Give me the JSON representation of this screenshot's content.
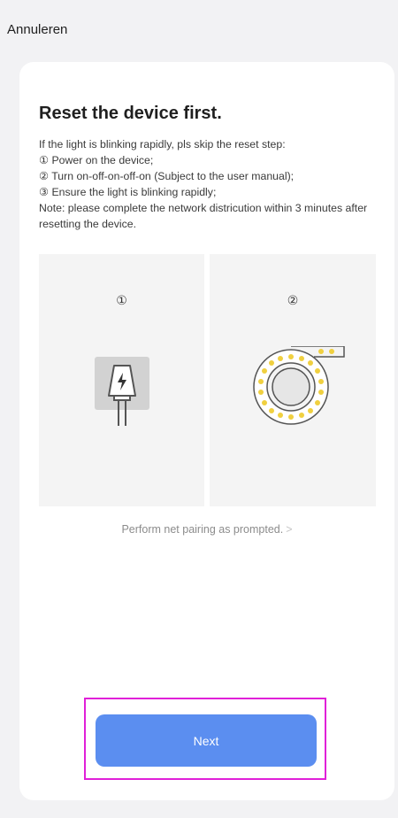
{
  "header": {
    "cancel_label": "Annuleren"
  },
  "main": {
    "title": "Reset the device first.",
    "instructions": {
      "intro": "If the light is blinking rapidly, pls skip the reset step:",
      "step1": "① Power on the device;",
      "step2": "② Turn on-off-on-off-on (Subject to the user manual);",
      "step3": "③ Ensure the light is blinking rapidly;",
      "note": "Note: please complete the network districution within 3 minutes after resetting the device."
    },
    "illustrations": [
      {
        "step_label": "①",
        "icon": "power-plug-icon"
      },
      {
        "step_label": "②",
        "icon": "blinking-light-ring-icon"
      }
    ],
    "hint_link": "Perform net pairing as prompted.",
    "hint_chevron": ">"
  },
  "footer": {
    "next_label": "Next"
  },
  "colors": {
    "accent": "#5b8ef0",
    "highlight": "#e020d8",
    "led": "#f0d040"
  }
}
